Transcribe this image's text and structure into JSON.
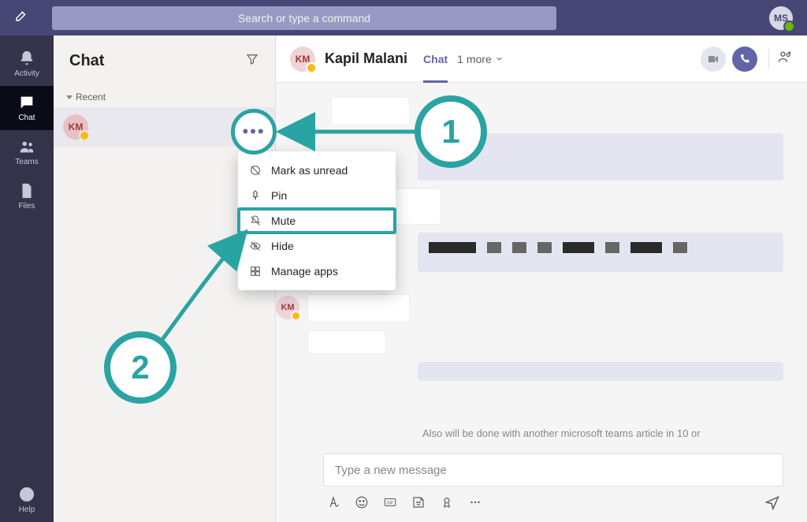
{
  "topbar": {
    "search_placeholder": "Search or type a command",
    "user_initials": "MS"
  },
  "rail": {
    "activity": "Activity",
    "chat": "Chat",
    "teams": "Teams",
    "files": "Files",
    "help": "Help"
  },
  "chatlist": {
    "title": "Chat",
    "section_recent": "Recent",
    "row_initials": "KM"
  },
  "chat_header": {
    "avatar_initials": "KM",
    "title_name": "Kapil Malani",
    "tab_chat": "Chat",
    "more_tabs": "1 more"
  },
  "context_menu": {
    "mark_unread": "Mark as unread",
    "pin": "Pin",
    "mute": "Mute",
    "hide": "Hide",
    "manage_apps": "Manage apps"
  },
  "annotations": {
    "step1": "1",
    "step2": "2"
  },
  "messages": {
    "inline_avatar": "KM",
    "cut_text": "Also will be done with another microsoft teams article in 10 or"
  },
  "compose": {
    "placeholder": "Type a new message"
  }
}
